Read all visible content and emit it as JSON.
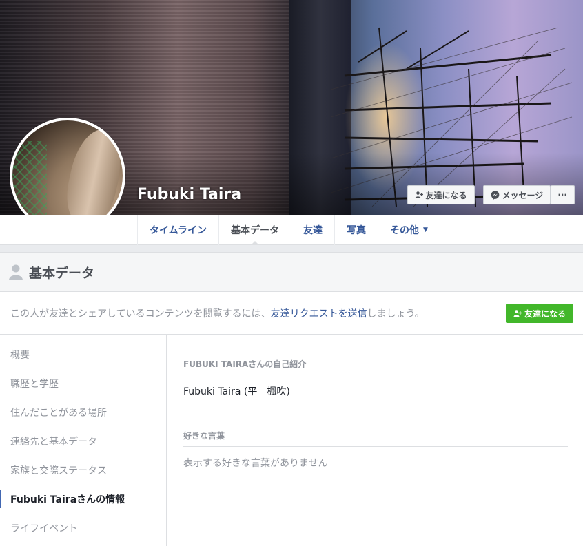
{
  "profile": {
    "name": "Fubuki Taira"
  },
  "cover_actions": {
    "add_friend": "友達になる",
    "message": "メッセージ",
    "more": "···"
  },
  "tabs": [
    {
      "label": "タイムライン"
    },
    {
      "label": "基本データ"
    },
    {
      "label": "友達"
    },
    {
      "label": "写真"
    },
    {
      "label": "その他"
    }
  ],
  "section": {
    "title": "基本データ"
  },
  "notice": {
    "prefix": "この人が友達とシェアしているコンテンツを閲覧するには、",
    "link": "友達リクエストを送信",
    "suffix": "しましょう。",
    "button": "友達になる"
  },
  "leftnav": {
    "items": [
      {
        "label": "概要"
      },
      {
        "label": "職歴と学歴"
      },
      {
        "label": "住んだことがある場所"
      },
      {
        "label": "連絡先と基本データ"
      },
      {
        "label": "家族と交際ステータス"
      },
      {
        "label": "Fubuki Tairaさんの情報"
      },
      {
        "label": "ライフイベント"
      }
    ]
  },
  "content": {
    "about_heading": "FUBUKI TAIRAさんの自己紹介",
    "about_text": "Fubuki Taira (平　楓吹)",
    "quotes_heading": "好きな言葉",
    "quotes_text": "表示する好きな言葉がありません"
  },
  "colors": {
    "link": "#365899",
    "green": "#42b72a",
    "muted": "#90949c"
  }
}
